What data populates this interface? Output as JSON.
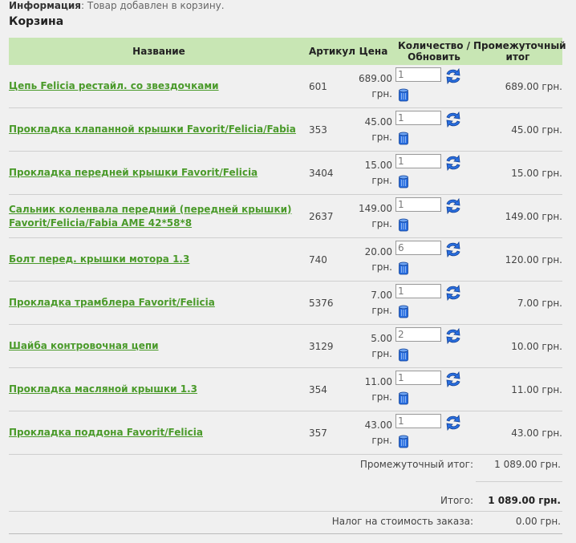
{
  "info": {
    "label": "Информация",
    "text": ": Товар добавлен в корзину."
  },
  "cart_title": "Корзина",
  "headers": {
    "name": "Название",
    "article": "Артикул",
    "price": "Цена",
    "qty": "Количество / Обновить",
    "subtotal": "Промежуточный итог"
  },
  "items": [
    {
      "name": "Цепь Felicia рестайл. со звездочками",
      "article": "601",
      "price": "689.00",
      "currency": "грн.",
      "qty": "1",
      "total": "689.00 грн."
    },
    {
      "name": "Прокладка клапанной крышки Favorit/Felicia/Fabia",
      "article": "353",
      "price": "45.00",
      "currency": "грн.",
      "qty": "1",
      "total": "45.00 грн."
    },
    {
      "name": "Прокладка передней крышки Favorit/Felicia",
      "article": "3404",
      "price": "15.00",
      "currency": "грн.",
      "qty": "1",
      "total": "15.00 грн."
    },
    {
      "name": "Сальник коленвала передний (передней крышки) Favorit/Felicia/Fabia AME 42*58*8",
      "article": "2637",
      "price": "149.00",
      "currency": "грн.",
      "qty": "1",
      "total": "149.00 грн."
    },
    {
      "name": "Болт перед. крышки мотора 1.3",
      "article": "740",
      "price": "20.00",
      "currency": "грн.",
      "qty": "6",
      "total": "120.00 грн."
    },
    {
      "name": "Прокладка трамблера Favorit/Felicia",
      "article": "5376",
      "price": "7.00",
      "currency": "грн.",
      "qty": "1",
      "total": "7.00 грн."
    },
    {
      "name": "Шайба контровочная цепи",
      "article": "3129",
      "price": "5.00",
      "currency": "грн.",
      "qty": "2",
      "total": "10.00 грн."
    },
    {
      "name": "Прокладка масляной крышки 1.3",
      "article": "354",
      "price": "11.00",
      "currency": "грн.",
      "qty": "1",
      "total": "11.00 грн."
    },
    {
      "name": "Прокладка поддона Favorit/Felicia",
      "article": "357",
      "price": "43.00",
      "currency": "грн.",
      "qty": "1",
      "total": "43.00 грн."
    }
  ],
  "summary": {
    "subtotal_label": "Промежуточный итог:",
    "subtotal_value": "1 089.00 грн.",
    "total_label": "Итого:",
    "total_value": "1 089.00 грн.",
    "tax_label": "Налог на стоимость заказа:",
    "tax_value": "0.00 грн."
  },
  "colors": {
    "header_bg": "#c8e6b4",
    "link": "#4a9a2a",
    "icon_blue": "#1f5fd1"
  }
}
